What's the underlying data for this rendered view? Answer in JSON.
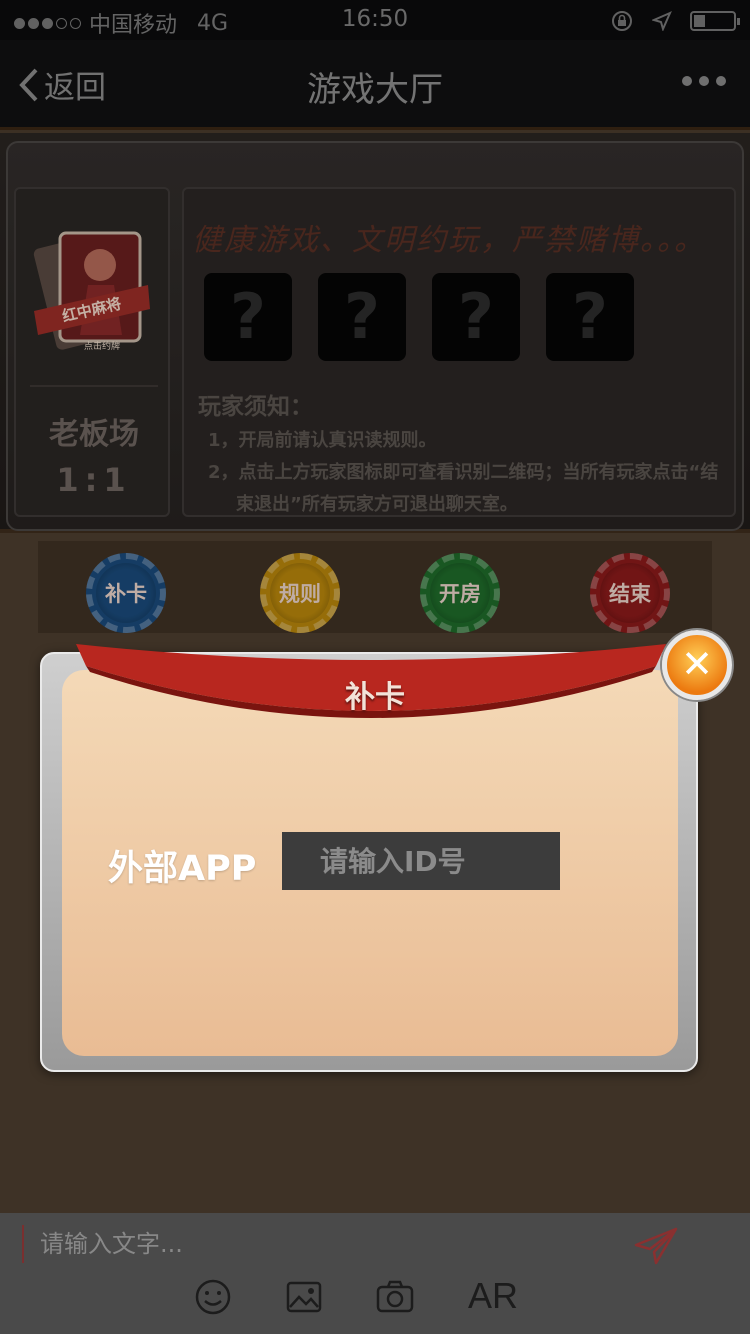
{
  "status_bar": {
    "carrier": "中国移动",
    "network": "4G",
    "time": "16:50",
    "signal_bars_on": 3,
    "signal_bars_total": 5,
    "battery_level": 0.3
  },
  "nav": {
    "back_label": "返回",
    "title": "游戏大厅"
  },
  "game": {
    "card_label": "红中麻将",
    "card_sub": "点击约牌",
    "room_type": "老板场",
    "room_ratio": "1:1",
    "slogan": "健康游戏、文明约玩，严禁赌博。。。",
    "seats": [
      "?",
      "?",
      "?",
      "?"
    ],
    "notice_title": "玩家须知：",
    "notice_lines": [
      "1，开局前请认真识读规则。",
      "2，点击上方玩家图标即可查看识别二维码；当所有玩家点击“结",
      "束退出”所有玩家方可退出聊天室。"
    ]
  },
  "chips": [
    {
      "label": "补卡",
      "color": "#1a4a7a"
    },
    {
      "label": "规则",
      "color": "#b8860b"
    },
    {
      "label": "开房",
      "color": "#1f6b2a"
    },
    {
      "label": "结束",
      "color": "#8a1a1a"
    }
  ],
  "modal": {
    "title": "补卡",
    "close_symbol": "✕",
    "field_label": "外部APP",
    "input_placeholder": "请输入ID号"
  },
  "chat": {
    "input_placeholder": "请输入文字...",
    "ar_label": "AR"
  },
  "icons": {
    "send": "send-icon",
    "emoji": "emoji-icon",
    "image": "image-icon",
    "camera": "camera-icon"
  }
}
